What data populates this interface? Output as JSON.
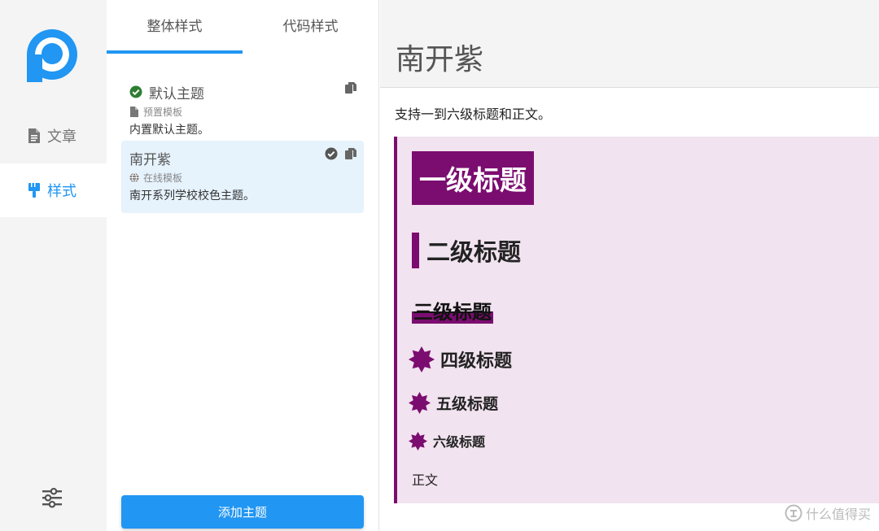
{
  "colors": {
    "accent": "#2196f3",
    "theme_purple": "#7b0d70",
    "preview_bg": "#f1e3ef",
    "check_green": "#2e7d32"
  },
  "nav": {
    "items": [
      {
        "label": "文章",
        "icon": "document-icon"
      },
      {
        "label": "样式",
        "icon": "paintbrush-icon"
      }
    ],
    "active": "样式"
  },
  "tabs": [
    {
      "label": "整体样式"
    },
    {
      "label": "代码样式"
    }
  ],
  "themes": [
    {
      "title": "默认主题",
      "source": "预置模板",
      "source_icon": "file-icon",
      "desc": "内置默认主题。"
    },
    {
      "title": "南开紫",
      "source": "在线模板",
      "source_icon": "globe-icon",
      "desc": "南开系列学校校色主题。"
    }
  ],
  "add_button": "添加主题",
  "preview": {
    "title": "南开紫",
    "intro": "支持一到六级标题和正文。",
    "h1": "一级标题",
    "h2": "二级标题",
    "h3": "三级标题",
    "h4": "四级标题",
    "h5": "五级标题",
    "h6": "六级标题",
    "body": "正文"
  },
  "watermark": "什么值得买"
}
